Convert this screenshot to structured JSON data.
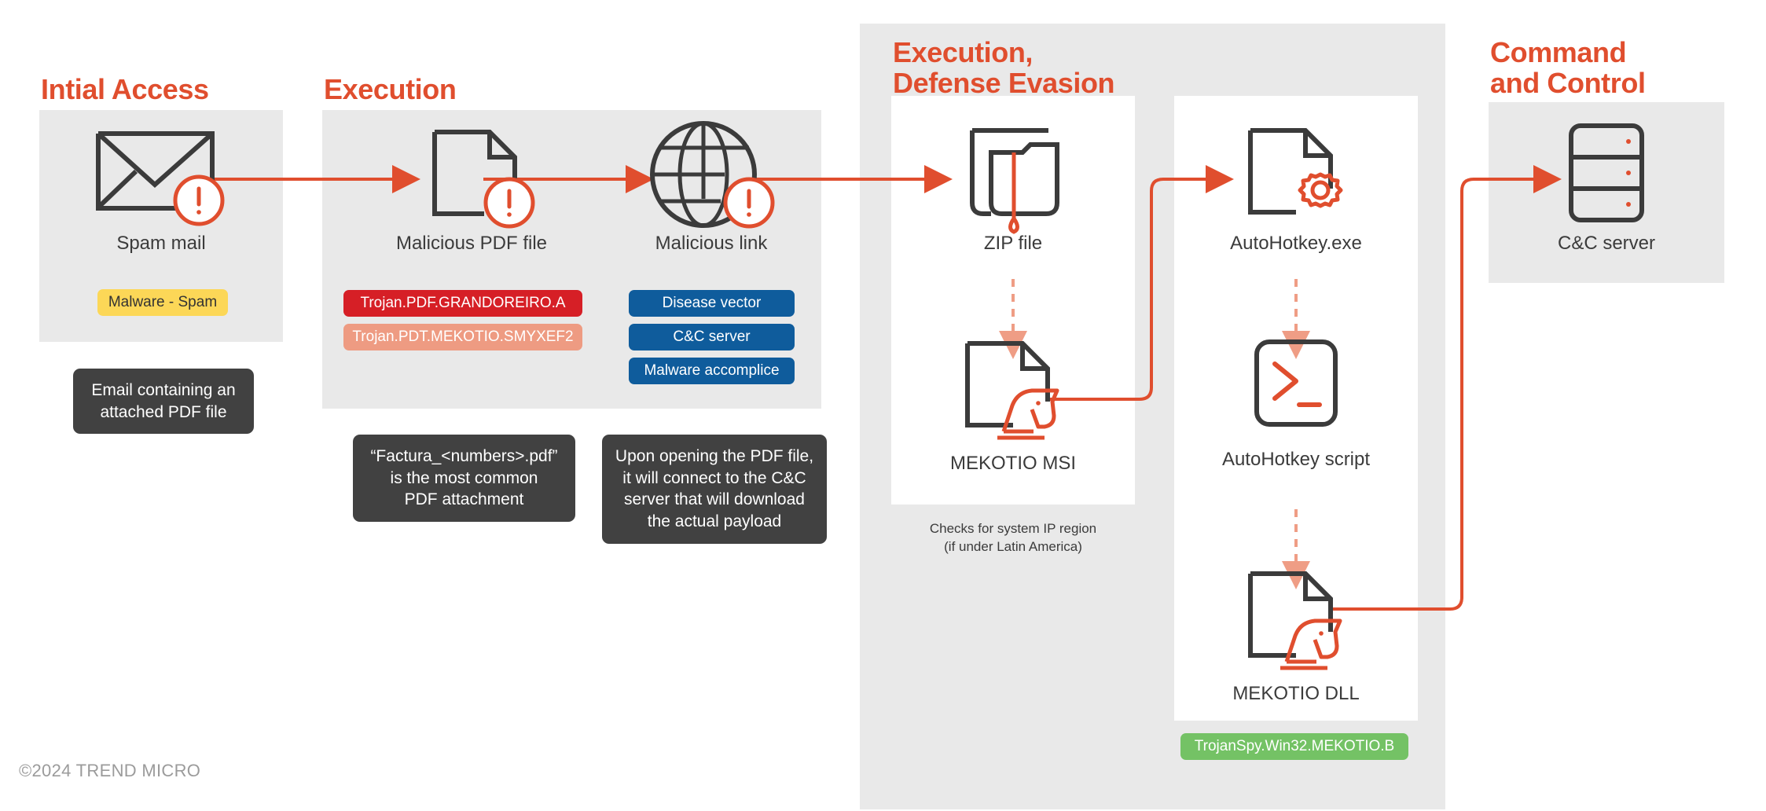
{
  "diagram": {
    "footer": "©2024 TREND MICRO",
    "accent": "#e04e2e",
    "panel_bg": "#e9e9e9",
    "dark_icon": "#3b3b3b"
  },
  "columns": [
    {
      "title": "Intial Access"
    },
    {
      "title": "Execution"
    },
    {
      "title": "Execution,\nDefense Evasion"
    },
    {
      "title": "Command\nand Control"
    }
  ],
  "nodes": {
    "spam_mail": {
      "label": "Spam mail",
      "icon": "envelope-alert-icon"
    },
    "malicious_pdf": {
      "label": "Malicious PDF file",
      "icon": "document-alert-icon"
    },
    "malicious_link": {
      "label": "Malicious link",
      "icon": "globe-alert-icon"
    },
    "zip_file": {
      "label": "ZIP file",
      "icon": "folder-drip-icon"
    },
    "mekotio_msi": {
      "label": "MEKOTIO MSI",
      "icon": "document-trojan-horse-icon"
    },
    "autohotkey_exe": {
      "label": "AutoHotkey.exe",
      "icon": "document-gear-icon"
    },
    "autohotkey_script": {
      "label": "AutoHotkey script",
      "icon": "terminal-icon"
    },
    "mekotio_dll": {
      "label": "MEKOTIO DLL",
      "icon": "document-trojan-horse-icon"
    },
    "cnc_server": {
      "label": "C&C server",
      "icon": "server-rack-icon"
    }
  },
  "badges": {
    "spam": [
      {
        "text": "Malware - Spam",
        "color": "#fcd757"
      }
    ],
    "pdf": [
      {
        "text": "Trojan.PDF.GRANDOREIRO.A",
        "color": "#d61f26"
      },
      {
        "text": "Trojan.PDT.MEKOTIO.SMYXEF2",
        "color": "#ee9b82"
      }
    ],
    "link": [
      {
        "text": "Disease vector",
        "color": "#0f5c9c"
      },
      {
        "text": "C&C server",
        "color": "#0f5c9c"
      },
      {
        "text": "Malware accomplice",
        "color": "#0f5c9c"
      }
    ],
    "dll": [
      {
        "text": "TrojanSpy.Win32.MEKOTIO.B",
        "color": "#74c265"
      }
    ]
  },
  "tooltips": {
    "email": "Email containing an\nattached PDF file",
    "factura": "“Factura_<numbers>.pdf”\nis the most common\nPDF attachment",
    "payload": "Upon opening the PDF file,\nit will connect to the C&C\nserver that will download\nthe actual payload"
  },
  "captions": {
    "ip_region": "Checks for system IP region\n(if under Latin America)"
  }
}
